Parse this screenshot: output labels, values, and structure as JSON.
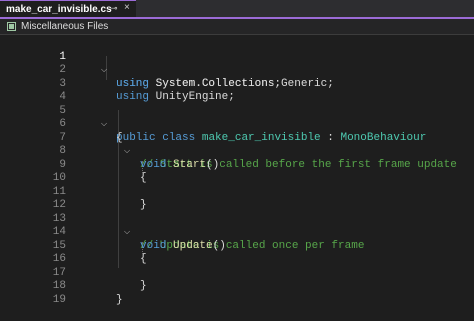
{
  "tab": {
    "title": "make_car_invisible.cs",
    "pin": "⊸",
    "close": "×"
  },
  "navbar": {
    "label": "Miscellaneous Files"
  },
  "code": {
    "line_numbers": [
      "1",
      "2",
      "3",
      "4",
      "5",
      "6",
      "7",
      "8",
      "9",
      "10",
      "11",
      "12",
      "13",
      "14",
      "15",
      "16",
      "17",
      "18",
      "19"
    ],
    "l1": [
      "using",
      " System.Collections;"
    ],
    "l2": [
      "using",
      " System.Collections.Generic;"
    ],
    "l3": [
      "using",
      " UnityEngine;"
    ],
    "l5": [
      "public",
      " ",
      "class",
      " ",
      "make_car_invisible",
      " : ",
      "MonoBehaviour"
    ],
    "l6": "{",
    "l7": "// Start is called before the first frame update",
    "l8": [
      "void",
      " ",
      "Start",
      "()"
    ],
    "l9": "{",
    "l11": "}",
    "l13": "// Update is called once per frame",
    "l14": [
      "void",
      " ",
      "Update",
      "()"
    ],
    "l15": "{",
    "l17": "}",
    "l18": "}"
  }
}
